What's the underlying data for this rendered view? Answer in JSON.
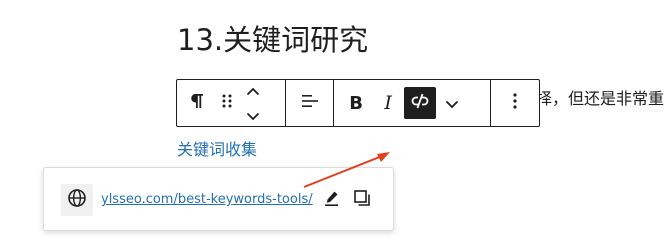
{
  "content": {
    "heading": "13.关键词研究",
    "body_fragment": "择，但还是非常重",
    "link_text": "关键词收集"
  },
  "toolbar": {
    "paragraph_icon": "pilcrow-icon",
    "drag_icon": "drag-handle-icon",
    "move_up_icon": "chevron-up-icon",
    "move_down_icon": "chevron-down-icon",
    "align_icon": "align-left-icon",
    "bold_label": "B",
    "italic_label": "I",
    "link_icon": "unlink-icon",
    "more_rich_text_icon": "chevron-down-icon",
    "options_icon": "more-vertical-icon"
  },
  "link_popover": {
    "url": "ylsseo.com/best-keywords-tools/",
    "globe_icon": "globe-icon",
    "edit_icon": "pencil-icon",
    "copy_icon": "copy-icon"
  },
  "colors": {
    "text": "#1e1e1e",
    "link": "#2271b1",
    "arrow": "#e0401e",
    "active_button_bg": "#1e1e1e"
  }
}
